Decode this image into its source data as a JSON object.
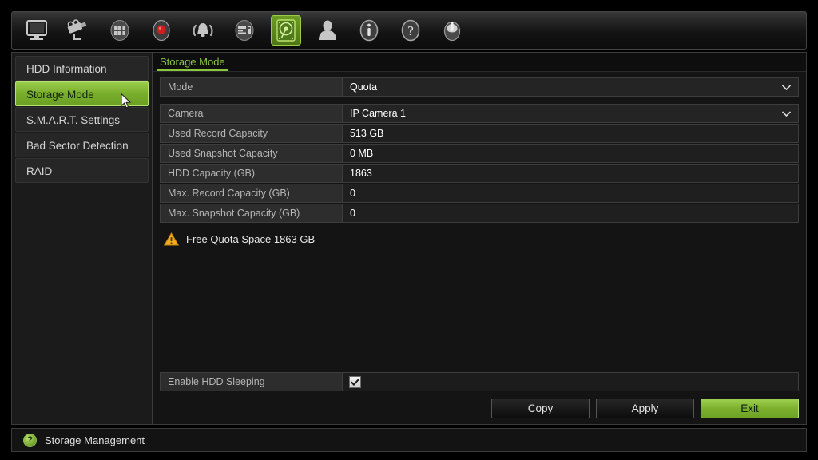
{
  "toolbar": {
    "items": [
      {
        "name": "monitor-icon",
        "label": "Live View"
      },
      {
        "name": "camera-icon",
        "label": "Camera"
      },
      {
        "name": "network-icon",
        "label": "Network"
      },
      {
        "name": "record-icon",
        "label": "Record"
      },
      {
        "name": "alarm-icon",
        "label": "Alarm"
      },
      {
        "name": "device-icon",
        "label": "Device"
      },
      {
        "name": "hdd-icon",
        "label": "HDD",
        "active": true
      },
      {
        "name": "user-icon",
        "label": "User"
      },
      {
        "name": "info-icon",
        "label": "Information"
      },
      {
        "name": "help-icon",
        "label": "Help"
      },
      {
        "name": "power-icon",
        "label": "Shutdown"
      }
    ]
  },
  "sidebar": {
    "items": [
      {
        "label": "HDD Information",
        "selected": false
      },
      {
        "label": "Storage Mode",
        "selected": true
      },
      {
        "label": "S.M.A.R.T. Settings",
        "selected": false
      },
      {
        "label": "Bad Sector Detection",
        "selected": false
      },
      {
        "label": "RAID",
        "selected": false
      }
    ]
  },
  "main": {
    "tab_label": "Storage Mode",
    "mode_row": {
      "label": "Mode",
      "value": "Quota"
    },
    "camera_row": {
      "label": "Camera",
      "value": "IP Camera 1"
    },
    "rows": [
      {
        "label": "Used Record Capacity",
        "value": "513 GB"
      },
      {
        "label": "Used Snapshot Capacity",
        "value": "0 MB"
      },
      {
        "label": "HDD Capacity (GB)",
        "value": "1863"
      },
      {
        "label": "Max. Record Capacity (GB)",
        "value": "0"
      },
      {
        "label": "Max. Snapshot Capacity (GB)",
        "value": "0"
      }
    ],
    "warning_text": "Free Quota Space 1863 GB",
    "sleep_label": "Enable HDD Sleeping",
    "sleep_checked": true
  },
  "buttons": {
    "copy": "Copy",
    "apply": "Apply",
    "exit": "Exit"
  },
  "statusbar": {
    "help_glyph": "?",
    "text": "Storage Management"
  },
  "colors": {
    "accent_green": "#8cc63f",
    "warning_amber": "#f0a818",
    "panel_bg": "#141414",
    "label_bg": "#2d2d2d"
  }
}
